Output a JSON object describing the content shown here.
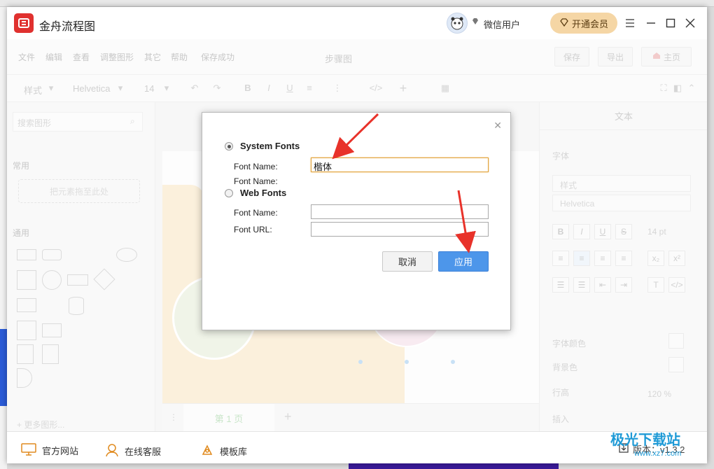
{
  "app": {
    "title": "金舟流程图",
    "user_name": "微信用户",
    "vip_label": "开通会员"
  },
  "menu": {
    "items": [
      "文件",
      "编辑",
      "查看",
      "调整图形",
      "其它",
      "帮助",
      "保存成功"
    ],
    "doc_title": "步骤图",
    "save_label": "保存",
    "export_label": "导出",
    "home_label": "主页"
  },
  "toolbar": {
    "style_label": "样式",
    "font_label": "Helvetica",
    "size_label": "14"
  },
  "left_panel": {
    "search_placeholder": "搜索图形",
    "section_common": "常用",
    "drop_zone": "把元素拖至此处",
    "section_general": "通用",
    "more_shapes": "更多图形..."
  },
  "canvas": {
    "page_tab": "第 1 页"
  },
  "right_panel": {
    "title": "文本",
    "font_section": "字体",
    "style_select": "样式",
    "font_select": "Helvetica",
    "size_value": "14 pt",
    "font_color_label": "字体颜色",
    "bg_color_label": "背景色",
    "line_height_label": "行高",
    "line_height_value": "120 %",
    "insert_label": "插入"
  },
  "dialog": {
    "system_fonts_label": "System Fonts",
    "system_font_name_label": "Font Name:",
    "system_font_name_value": "楷体",
    "font_name_extra_label": "Font Name:",
    "web_fonts_label": "Web Fonts",
    "web_font_name_label": "Font Name:",
    "web_font_name_value": "",
    "web_font_url_label": "Font URL:",
    "web_font_url_value": "",
    "cancel_label": "取消",
    "apply_label": "应用",
    "selected_mode": "System Fonts"
  },
  "bottom_bar": {
    "official_site": "官方网站",
    "online_service": "在线客服",
    "template_library": "模板库",
    "version": "版本：v1.3.2"
  },
  "watermark": {
    "brand": "极光下载站",
    "url": "www.xz7.com"
  },
  "colors": {
    "brand_red": "#e0312f",
    "vip_gold": "#f5d6a5",
    "apply_blue": "#4d96ea",
    "focus_orange": "#e0a23a",
    "annotation_red": "#e8322a"
  }
}
